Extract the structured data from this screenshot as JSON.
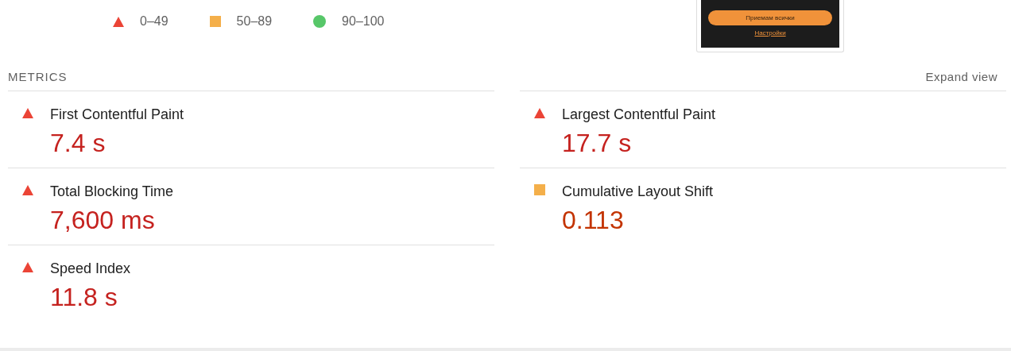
{
  "legend": [
    {
      "kind": "fail",
      "label": "0–49"
    },
    {
      "kind": "average",
      "label": "50–89"
    },
    {
      "kind": "pass",
      "label": "90–100"
    }
  ],
  "thumbnail": {
    "button": "Приемам всички",
    "link": "Настройки"
  },
  "metrics": {
    "title": "METRICS",
    "toggle": "Expand view",
    "items": [
      {
        "kind": "fail",
        "name": "First Contentful Paint",
        "value": "7.4 s"
      },
      {
        "kind": "fail",
        "name": "Largest Contentful Paint",
        "value": "17.7 s"
      },
      {
        "kind": "fail",
        "name": "Total Blocking Time",
        "value": "7,600 ms"
      },
      {
        "kind": "average",
        "name": "Cumulative Layout Shift",
        "value": "0.113"
      },
      {
        "kind": "fail",
        "name": "Speed Index",
        "value": "11.8 s"
      }
    ]
  }
}
